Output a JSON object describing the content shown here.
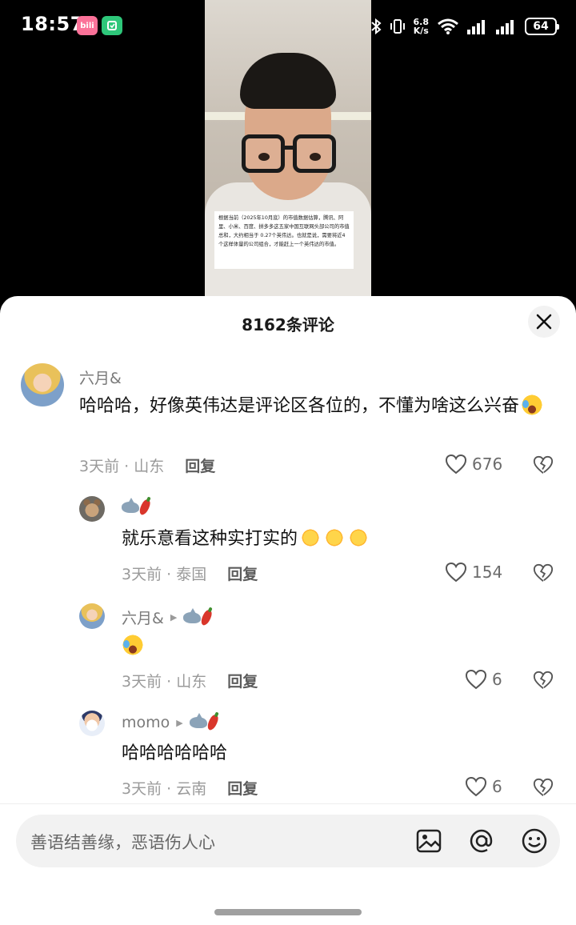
{
  "status_bar": {
    "time": "18:57",
    "app_badges": [
      "bili",
      "mi"
    ],
    "network_speed_value": "6.8",
    "network_speed_unit": "K/s",
    "battery": "64"
  },
  "video": {
    "caption": "根据当前（2025年10月底）的市值数据估算，腾讯、阿里、小米、百度、拼多多这五家中国互联网头部公司的市值总和，大约相当于 0.27个英伟达。也就是说，需要将近4个这样体量的公司组合，才能赶上一个英伟达的市值。"
  },
  "comments_panel": {
    "title": "8162条评论",
    "comments": [
      {
        "username": "六月&",
        "text": "哈哈哈，好像英伟达是评论区各位的，不懂为啥这么兴奋",
        "time_location": "3天前 · 山东",
        "reply_label": "回复",
        "likes": "676"
      },
      {
        "username": "",
        "text": "就乐意看这种实打实的",
        "time_location": "3天前 · 泰国",
        "reply_label": "回复",
        "likes": "154"
      },
      {
        "username": "六月&",
        "text": "",
        "time_location": "3天前 · 山东",
        "reply_label": "回复",
        "likes": "6"
      },
      {
        "username": "momo",
        "text": "哈哈哈哈哈哈",
        "time_location": "3天前 · 云南",
        "reply_label": "回复",
        "likes": "6"
      }
    ]
  },
  "input_bar": {
    "placeholder": "善语结善缘，恶语伤人心"
  },
  "icons": {
    "close": "close-icon",
    "like": "heart-outline-icon",
    "dislike": "broken-heart-icon",
    "image": "image-icon",
    "mention": "at-icon",
    "emoji": "smiley-icon"
  }
}
